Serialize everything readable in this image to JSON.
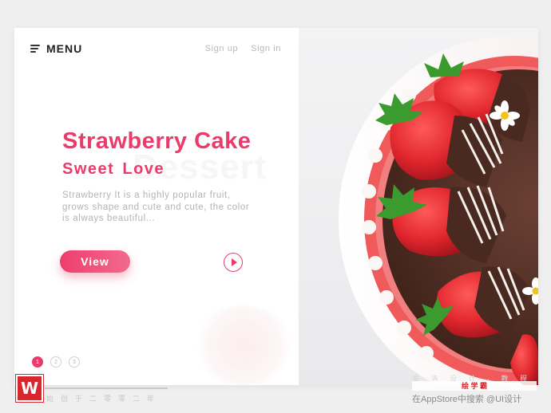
{
  "header": {
    "menu_label": "MENU",
    "sign_up": "Sign up",
    "sign_in": "Sign in"
  },
  "hero": {
    "background_word": "Dessert",
    "title": "Strawberry Cake",
    "subtitle": "Sweet  Love",
    "description": "Strawberry It is a highly popular fruit, grows shape and cute and cute, the color is always beautiful...",
    "view_label": "View"
  },
  "pagination": {
    "pages": [
      "1",
      "2",
      "3"
    ],
    "active_page": 1
  },
  "watermark": {
    "logo_letter": "W",
    "chars": "始创于二零零二年",
    "right_line1": "爱 洛 设 计 · 教 程",
    "right_line2": "绘 学 霸",
    "right_line3": "在AppStore中搜索  @UI设计"
  },
  "colors": {
    "accent": "#ec3b6b",
    "muted_text": "#b3b3b3",
    "watermark_red": "#d8262c"
  },
  "icons": {
    "menu": "hamburger-menu-icon",
    "play": "play-icon"
  }
}
